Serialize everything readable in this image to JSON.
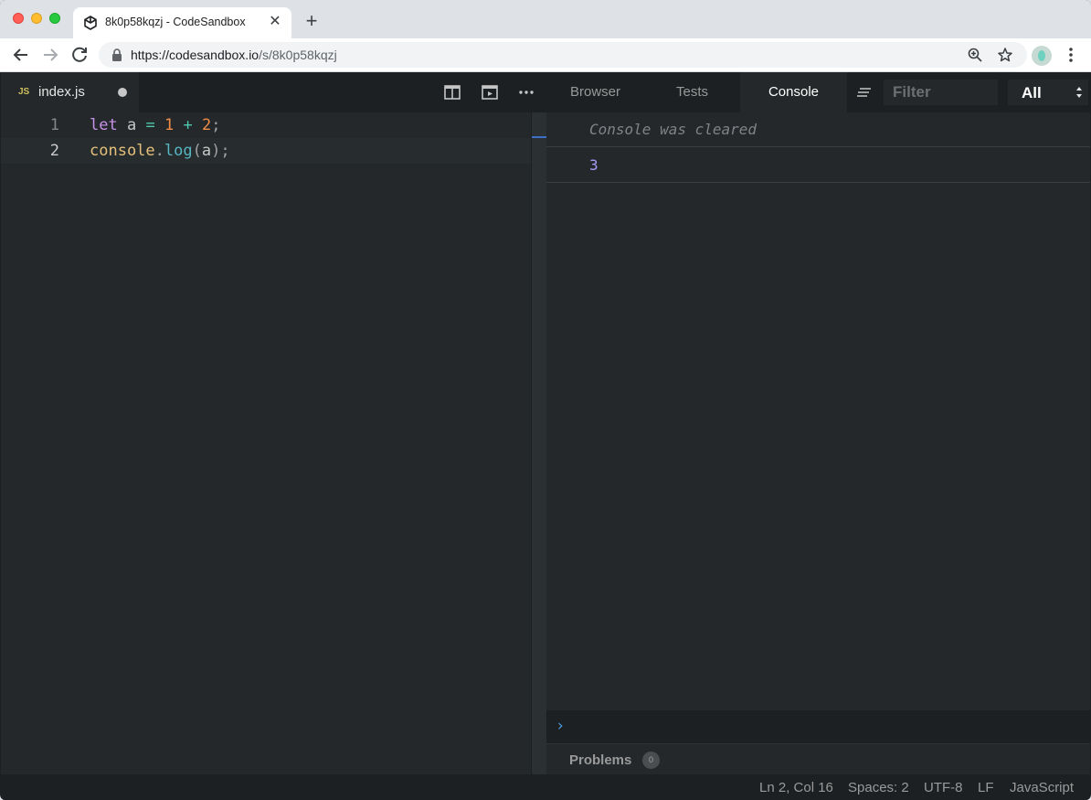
{
  "browser": {
    "tab_title": "8k0p58kqzj - CodeSandbox",
    "url_host": "https://codesandbox.io",
    "url_path": "/s/8k0p58kqzj"
  },
  "editor": {
    "file": {
      "badge": "JS",
      "name": "index.js",
      "unsaved": true
    },
    "lines": [
      {
        "number": "1",
        "tokens": [
          [
            "kw",
            "let"
          ],
          [
            "plain",
            " a "
          ],
          [
            "op",
            "="
          ],
          [
            "plain",
            " "
          ],
          [
            "num",
            "1"
          ],
          [
            "plain",
            " "
          ],
          [
            "op",
            "+"
          ],
          [
            "plain",
            " "
          ],
          [
            "num",
            "2"
          ],
          [
            "punc",
            ";"
          ]
        ]
      },
      {
        "number": "2",
        "tokens": [
          [
            "obj",
            "console"
          ],
          [
            "punc",
            "."
          ],
          [
            "fn",
            "log"
          ],
          [
            "punc",
            "("
          ],
          [
            "plain",
            "a"
          ],
          [
            "punc",
            ");"
          ]
        ]
      }
    ],
    "current_line": 2
  },
  "preview": {
    "tabs": [
      {
        "label": "Browser",
        "active": false
      },
      {
        "label": "Tests",
        "active": false
      },
      {
        "label": "Console",
        "active": true
      }
    ],
    "filter_placeholder": "Filter",
    "level": "All"
  },
  "console": {
    "cleared_message": "Console was cleared",
    "entries": [
      "3"
    ],
    "prompt": "›"
  },
  "problems": {
    "label": "Problems",
    "count": "0"
  },
  "status": {
    "position": "Ln 2, Col 16",
    "spaces": "Spaces: 2",
    "encoding": "UTF-8",
    "eol": "LF",
    "language": "JavaScript"
  },
  "colors": {
    "editor_bg": "#24282a",
    "chrome_bg": "#1c2022",
    "keyword": "#c792ea",
    "number": "#f08d49",
    "log_value": "#a79cf6"
  }
}
